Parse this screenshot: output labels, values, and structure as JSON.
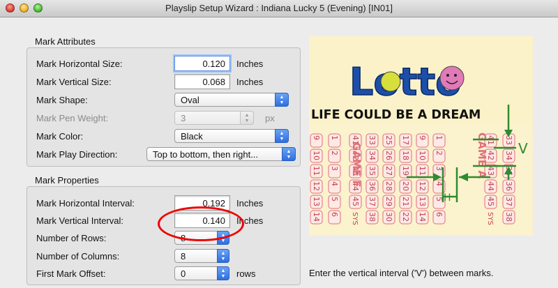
{
  "window": {
    "title": "Playslip Setup Wizard : Indiana Lucky 5 (Evening) [IN01]"
  },
  "mark_attributes": {
    "title": "Mark Attributes",
    "horizontal_size": {
      "label": "Mark Horizontal Size:",
      "value": "0.120",
      "unit": "Inches"
    },
    "vertical_size": {
      "label": "Mark Vertical Size:",
      "value": "0.068",
      "unit": "Inches"
    },
    "shape": {
      "label": "Mark Shape:",
      "value": "Oval"
    },
    "pen_weight": {
      "label": "Mark Pen Weight:",
      "value": "3",
      "unit": "px"
    },
    "color": {
      "label": "Mark Color:",
      "value": "Black"
    },
    "play_direction": {
      "label": "Mark Play Direction:",
      "value": "Top to bottom, then right..."
    }
  },
  "mark_properties": {
    "title": "Mark Properties",
    "horizontal_interval": {
      "label": "Mark Horizontal Interval:",
      "value": "0.192",
      "unit": "Inches"
    },
    "vertical_interval": {
      "label": "Mark Vertical Interval:",
      "value": "0.140",
      "unit": "Inches"
    },
    "rows": {
      "label": "Number of Rows:",
      "value": "8"
    },
    "columns": {
      "label": "Number of Columns:",
      "value": "8"
    },
    "first_offset": {
      "label": "First Mark Offset:",
      "value": "0",
      "unit": "rows"
    }
  },
  "preview": {
    "logo_text": "Lotto",
    "slogan": "LIFE COULD BE A DREAM",
    "game_labels": [
      "GAME F",
      "GAME A"
    ],
    "sys_label": "SYS",
    "interval_labels": {
      "vertical": "V",
      "horizontal": "H"
    },
    "column_numbers": [
      [
        "9",
        "10",
        "11",
        "12",
        "13",
        "14"
      ],
      [
        "1",
        "2",
        "3",
        "4",
        "5",
        "6"
      ],
      [
        "41",
        "42",
        "43",
        "44",
        "45"
      ],
      [
        "33",
        "34",
        "35",
        "36",
        "37",
        "38"
      ],
      [
        "25",
        "26",
        "27",
        "28",
        "29",
        "30"
      ],
      [
        "17",
        "18",
        "19",
        "20",
        "21",
        "22"
      ],
      [
        "9",
        "10",
        "11",
        "12",
        "13",
        "14"
      ],
      [
        "1",
        "2",
        "3",
        "4",
        "5",
        "6"
      ],
      [
        "41",
        "42",
        "43",
        "44",
        "45"
      ],
      [
        "33",
        "34",
        "35",
        "36",
        "37",
        "38"
      ]
    ]
  },
  "hint": "Enter the vertical interval ('V') between marks.",
  "colors": {
    "annotation_green": "#2e8b2e",
    "highlight_red": "#e00000",
    "slip_pink": "#e0707a"
  }
}
